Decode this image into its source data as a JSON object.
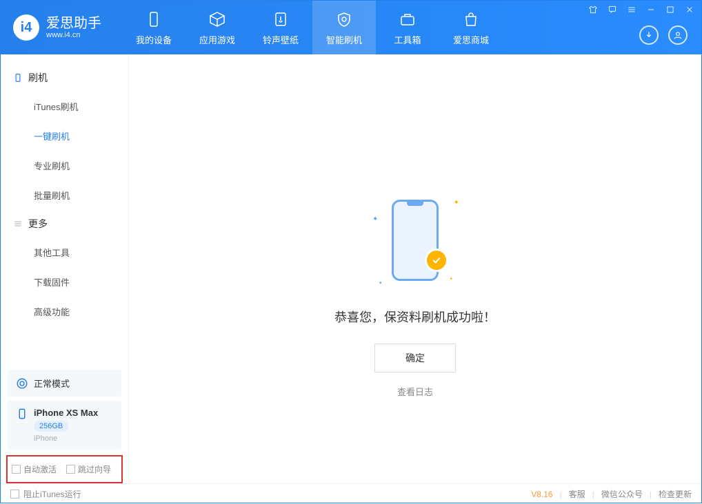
{
  "app": {
    "name": "爱思助手",
    "domain": "www.i4.cn"
  },
  "tabs": {
    "device": "我的设备",
    "apps": "应用游戏",
    "ringtone": "铃声壁纸",
    "flash": "智能刷机",
    "toolbox": "工具箱",
    "store": "爱思商城"
  },
  "sidebar": {
    "section_flash": "刷机",
    "items_flash": {
      "itunes": "iTunes刷机",
      "oneclick": "一键刷机",
      "pro": "专业刷机",
      "batch": "批量刷机"
    },
    "section_more": "更多",
    "items_more": {
      "other": "其他工具",
      "firmware": "下载固件",
      "advanced": "高级功能"
    }
  },
  "device": {
    "mode": "正常模式",
    "name": "iPhone XS Max",
    "capacity": "256GB",
    "type": "iPhone"
  },
  "options": {
    "auto_activate": "自动激活",
    "skip_guide": "跳过向导"
  },
  "main": {
    "success": "恭喜您，保资料刷机成功啦！",
    "confirm": "确定",
    "view_log": "查看日志"
  },
  "footer": {
    "block_itunes": "阻止iTunes运行",
    "version": "V8.16",
    "support": "客服",
    "wechat": "微信公众号",
    "update": "检查更新"
  }
}
